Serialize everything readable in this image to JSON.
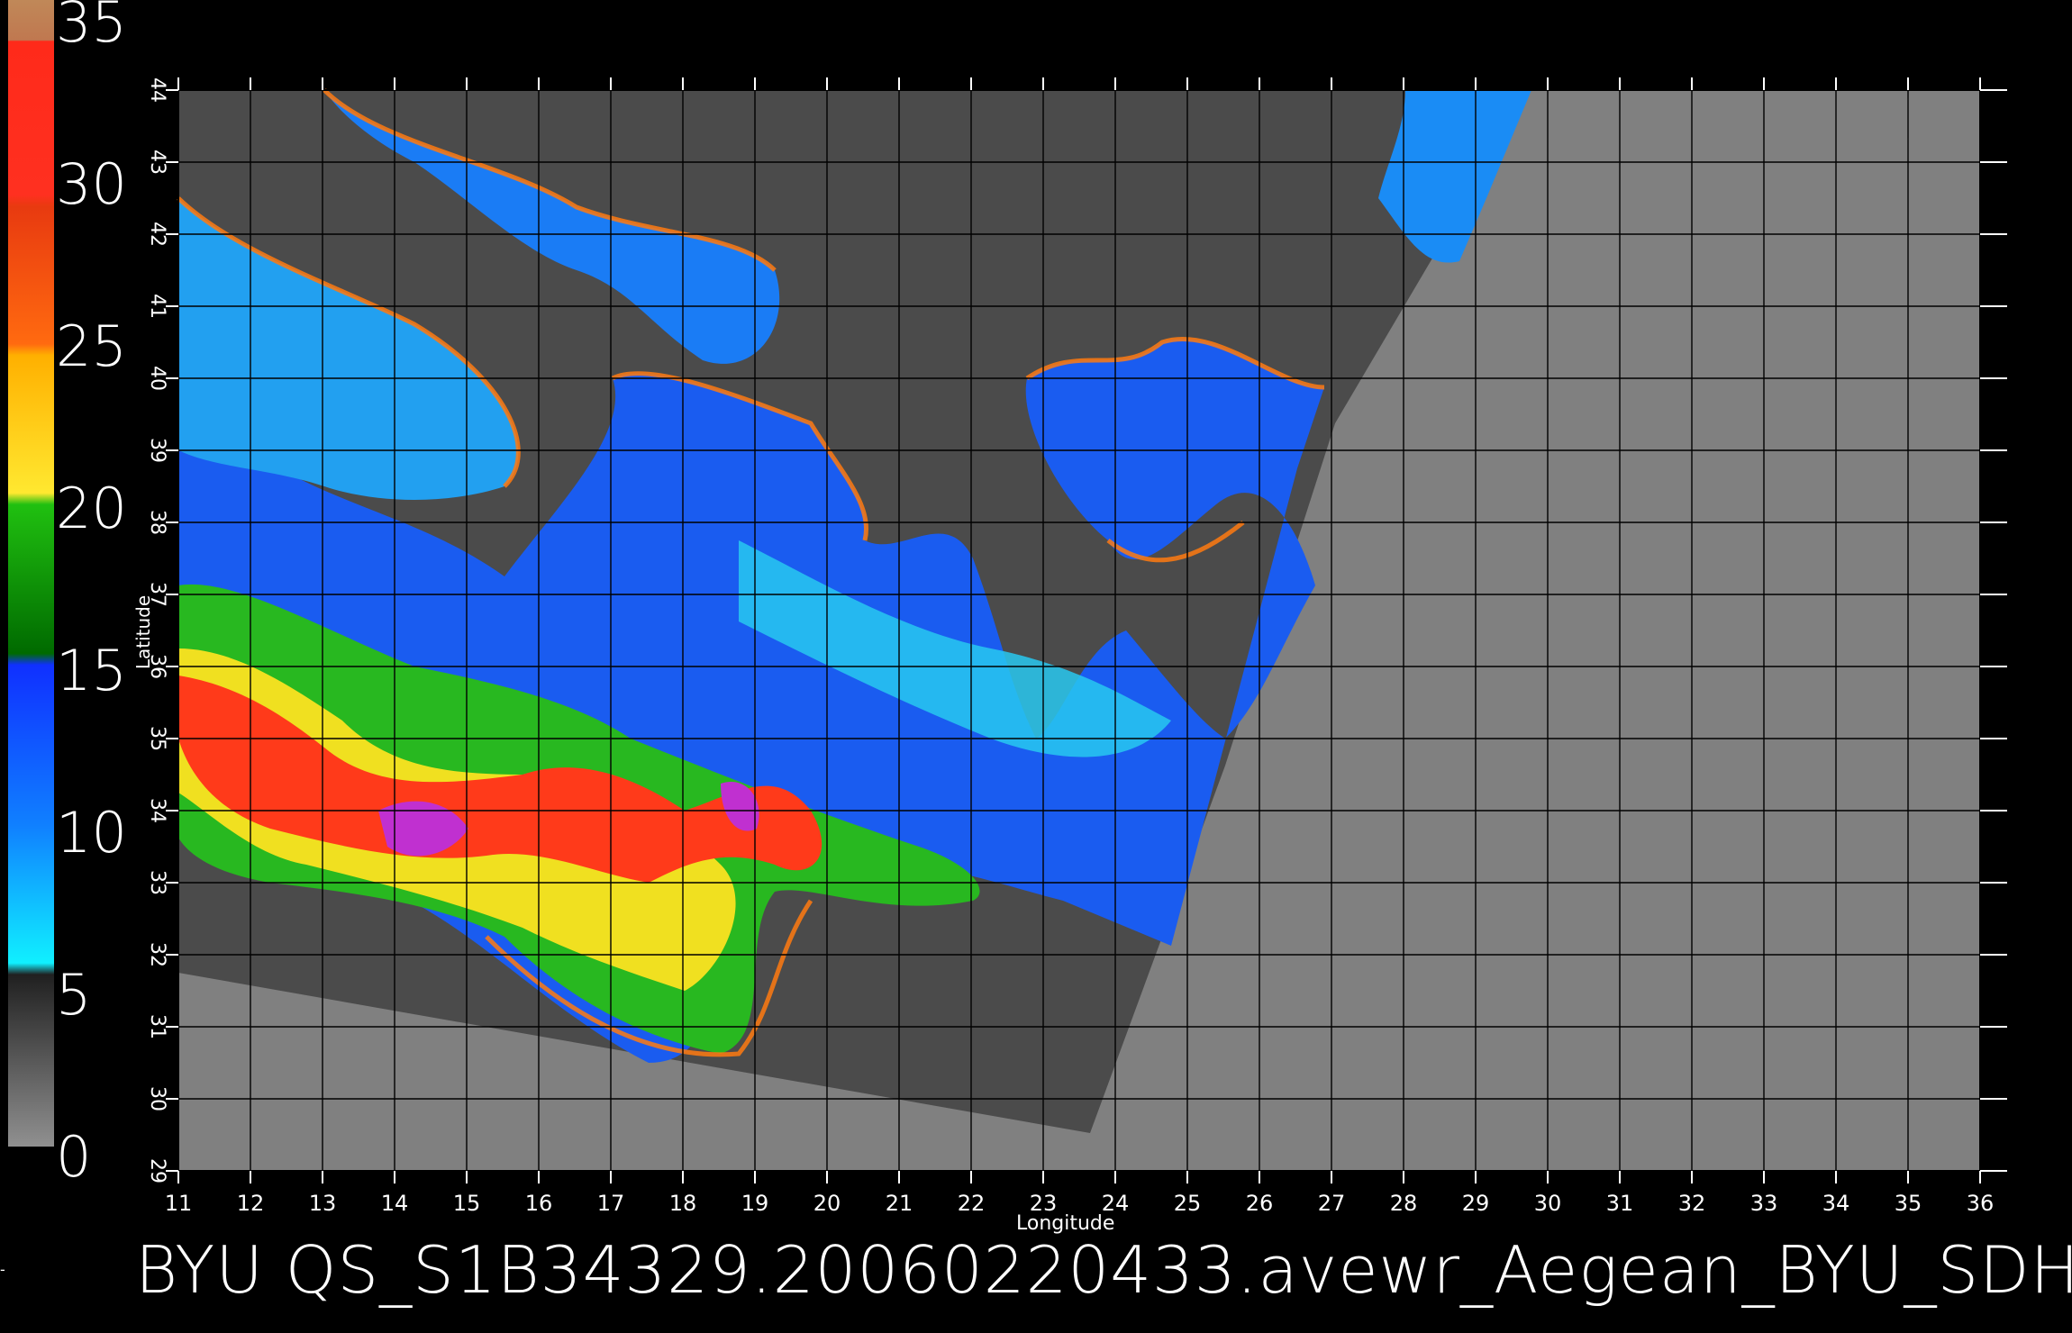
{
  "colorbar": {
    "tick_labels": [
      "35",
      "30",
      "25",
      "20",
      "15",
      "10",
      "5",
      "0"
    ],
    "segments": [
      {
        "color": "#c08050"
      },
      {
        "color": "#ff3a1a"
      },
      {
        "color": "#ff5a10"
      },
      {
        "color": "#ffd000"
      },
      {
        "color": "#00b800"
      },
      {
        "color": "#0050ff"
      },
      {
        "color": "#18a8ff"
      },
      {
        "color": "#606060"
      }
    ]
  },
  "axes": {
    "x_label": "Longitude",
    "y_label": "Latitude",
    "x_ticks": [
      "11",
      "12",
      "13",
      "14",
      "15",
      "16",
      "17",
      "18",
      "19",
      "20",
      "21",
      "22",
      "23",
      "24",
      "25",
      "26",
      "27",
      "28",
      "29",
      "30",
      "31",
      "32",
      "33",
      "34",
      "35",
      "36"
    ],
    "y_ticks": [
      "29",
      "30",
      "31",
      "32",
      "33",
      "34",
      "35",
      "36",
      "37",
      "38",
      "39",
      "40",
      "41",
      "42",
      "43",
      "44"
    ]
  },
  "colors": {
    "land": "#4b4b4b",
    "no_data": "#808080",
    "grid": "#000000"
  },
  "footer": {
    "title": "BYU  QS_S1B34329.20060220433.avewr_Aegean_BYU_SDH"
  },
  "left_mark": "-"
}
